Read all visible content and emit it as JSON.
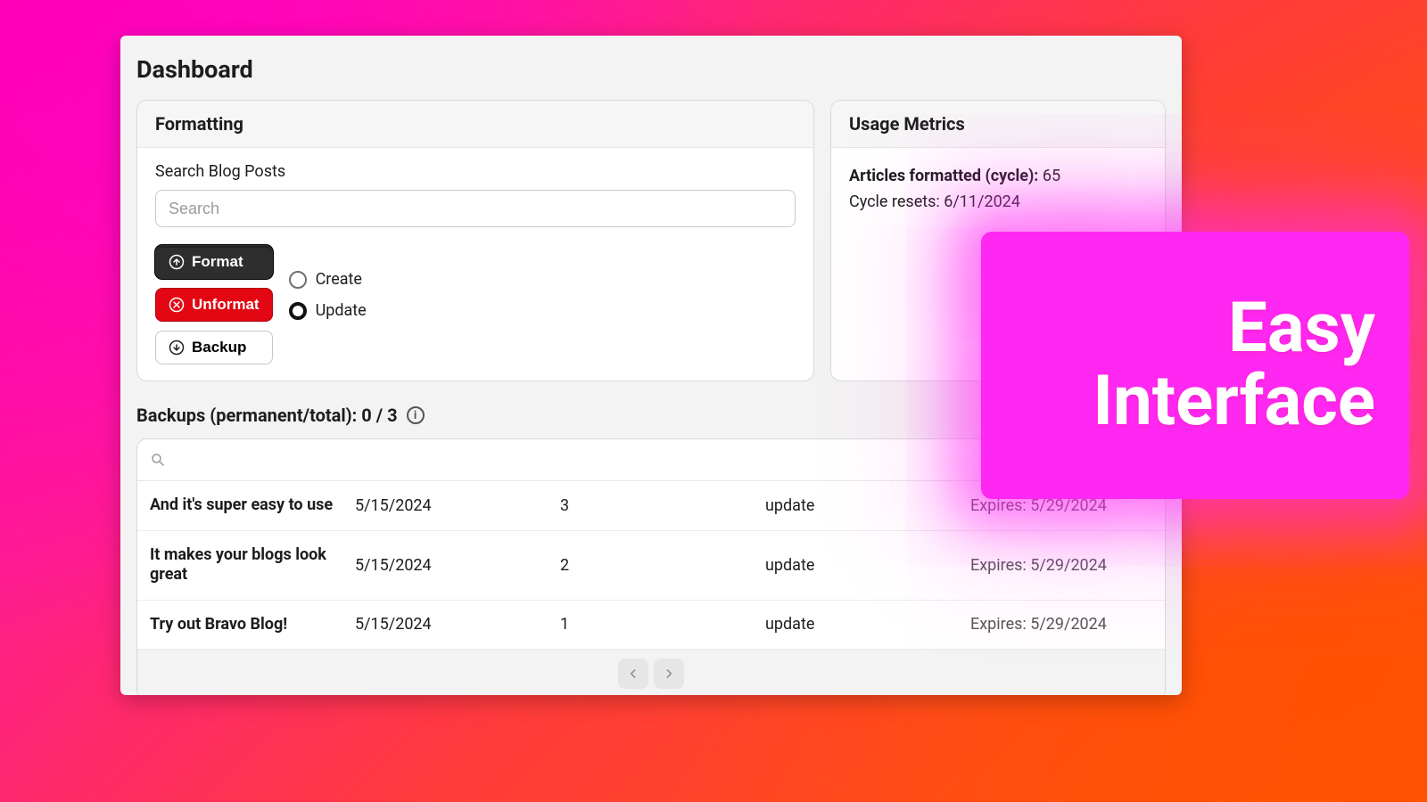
{
  "page": {
    "title": "Dashboard"
  },
  "formatting": {
    "card_title": "Formatting",
    "search_label": "Search Blog Posts",
    "search_placeholder": "Search",
    "buttons": {
      "format": "Format",
      "unformat": "Unformat",
      "backup": "Backup"
    },
    "radios": {
      "create": "Create",
      "update": "Update",
      "selected": "update"
    }
  },
  "metrics": {
    "card_title": "Usage Metrics",
    "formatted_label": "Articles formatted (cycle):",
    "formatted_value": "65",
    "reset_label": "Cycle resets:",
    "reset_value": "6/11/2024"
  },
  "backups": {
    "bar_label": "Backups (permanent/total): 0 / 3",
    "rows": [
      {
        "title": "And it's super easy to use",
        "date": "5/15/2024",
        "count": "3",
        "mode": "update",
        "expires": "Expires: 5/29/2024"
      },
      {
        "title": "It makes your blogs look great",
        "date": "5/15/2024",
        "count": "2",
        "mode": "update",
        "expires": "Expires: 5/29/2024"
      },
      {
        "title": "Try out Bravo Blog!",
        "date": "5/15/2024",
        "count": "1",
        "mode": "update",
        "expires": "Expires: 5/29/2024"
      }
    ]
  },
  "overlay": {
    "text": "Easy Interface"
  },
  "colors": {
    "accent_dark": "#2e2e2e",
    "accent_red": "#e30613",
    "overlay_pink": "#ff2ee6"
  }
}
